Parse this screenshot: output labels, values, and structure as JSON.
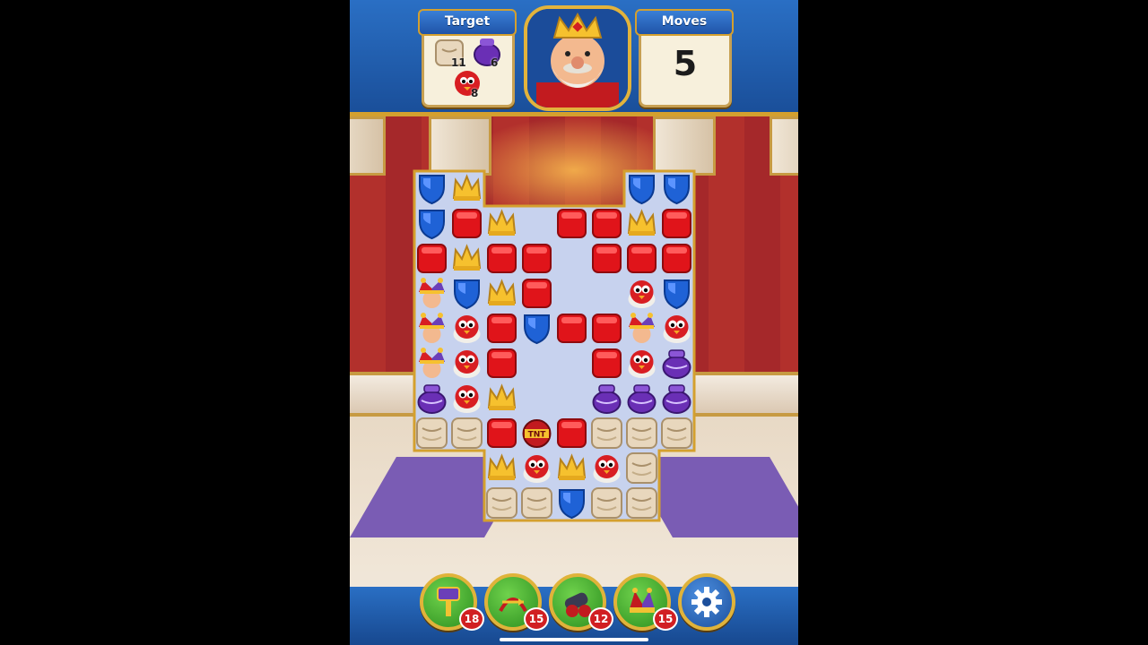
{
  "header": {
    "target_label": "Target",
    "moves_label": "Moves",
    "moves_value": "5",
    "portrait_icon": "king-portrait-icon",
    "targets": [
      {
        "icon": "sack-icon",
        "count": "11"
      },
      {
        "icon": "purple-pot-icon",
        "count": "6"
      },
      {
        "icon": "red-bird-icon",
        "count": "8"
      }
    ]
  },
  "boosters": [
    {
      "icon": "hammer-icon",
      "count": "18"
    },
    {
      "icon": "arrow-icon",
      "count": "15"
    },
    {
      "icon": "cannon-icon",
      "count": "12"
    },
    {
      "icon": "jester-hat-icon",
      "count": "15"
    }
  ],
  "settings_icon": "gear-icon",
  "board": {
    "rows": [
      "SC....SS",
      "SRC.RRCR",
      "RCRR.RRR",
      "JSCR..BS",
      "JBRSRRJB",
      "JBR..RBP",
      "PBC..PPP",
      "KKRTRKKK",
      "..CBCBK.",
      "..KKSKK."
    ],
    "legend": {
      "S": "blue-shield",
      "C": "gold-crown",
      "R": "red-block",
      "B": "red-bird",
      "J": "jester",
      "P": "purple-pot",
      "K": "sack",
      "T": "tnt-bomb",
      ".": "empty"
    }
  },
  "colors": {
    "header_blue": "#1f5cb0",
    "gold_trim": "#d4a02e",
    "wall_red": "#a5282a",
    "board_bg": "#c7d2ee",
    "booster_green": "#2c8f1f",
    "count_badge": "#d11f22"
  }
}
